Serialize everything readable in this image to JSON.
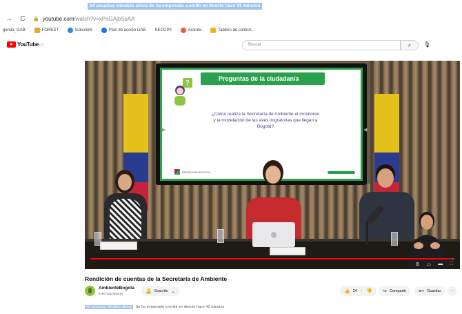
{
  "banner": {
    "text": "54 usuarios viéndolo ahora  Se ha empezado a emitir en directo hace 31 minutos"
  },
  "browser": {
    "url_host": "youtube.com",
    "url_path": "/watch?v=xPoGAjbSsAA",
    "bookmarks": [
      {
        "label": "genda_GAB",
        "color": "#ffffff"
      },
      {
        "label": "FOREST",
        "color": "#e8a53a"
      },
      {
        "label": "IsolucióN",
        "color": "#2a8ed6"
      },
      {
        "label": "Plan de acción GAB",
        "color": "#1a73e8"
      },
      {
        "label": "SECOPII",
        "color": "#ffffff"
      },
      {
        "label": "Aranda",
        "color": "#e85d4a"
      },
      {
        "label": "Tablero de control...",
        "color": "#f2b31b"
      }
    ]
  },
  "youtube": {
    "logo_text": "YouTube",
    "logo_region": "CO",
    "search_placeholder": "Buscar"
  },
  "video": {
    "slide_title": "Preguntas de la ciudadanía",
    "slide_question": "¿Cómo realiza la Secretaría de Ambiente el monitoreo y la modelación de las aves migratorias que llegan a Bogotá?",
    "slide_footer": "RENDICIÓN BOGOTÁ",
    "progress_fraction": 0.99
  },
  "meta": {
    "title": "Rendición de cuentas de la Secretaría de Ambiente",
    "channel_name": "AmbienteBogota",
    "channel_subs": "5760 suscriptores",
    "subscribe_label": "Suscrito",
    "like_count": "24",
    "share_label": "Compartir",
    "save_label": "Guardar",
    "more_label": "···"
  },
  "status": {
    "viewers": "43 usuarios viéndolo ahora",
    "since": "Se ha empezado a emitir en directo hace 43 minutos"
  },
  "colors": {
    "accent": "#ff0000",
    "slide_green": "#2ba14e",
    "highlight": "#9ec3f0"
  }
}
